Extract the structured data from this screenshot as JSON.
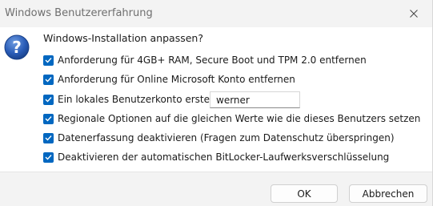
{
  "window": {
    "title": "Windows Benutzererfahrung"
  },
  "dialog": {
    "icon": "question-icon",
    "heading": "Windows-Installation anpassen?",
    "options": [
      {
        "label": "Anforderung für 4GB+ RAM, Secure Boot und TPM 2.0 entfernen",
        "checked": true
      },
      {
        "label": "Anforderung für Online Microsoft Konto entfernen",
        "checked": true
      },
      {
        "label": "Ein lokales Benutzerkonto erstellen:",
        "checked": true
      },
      {
        "label": "Regionale Optionen auf die gleichen Werte wie die dieses Benutzers setzen",
        "checked": true
      },
      {
        "label": "Datenerfassung deaktivieren (Fragen zum Datenschutz überspringen)",
        "checked": true
      },
      {
        "label": "Deaktivieren der automatischen BitLocker-Laufwerksverschlüsselung",
        "checked": true
      }
    ],
    "username_value": "werner"
  },
  "buttons": {
    "ok": "OK",
    "cancel": "Abbrechen"
  },
  "colors": {
    "accent": "#0067c0",
    "icon_blue": "#1f4fa3"
  }
}
